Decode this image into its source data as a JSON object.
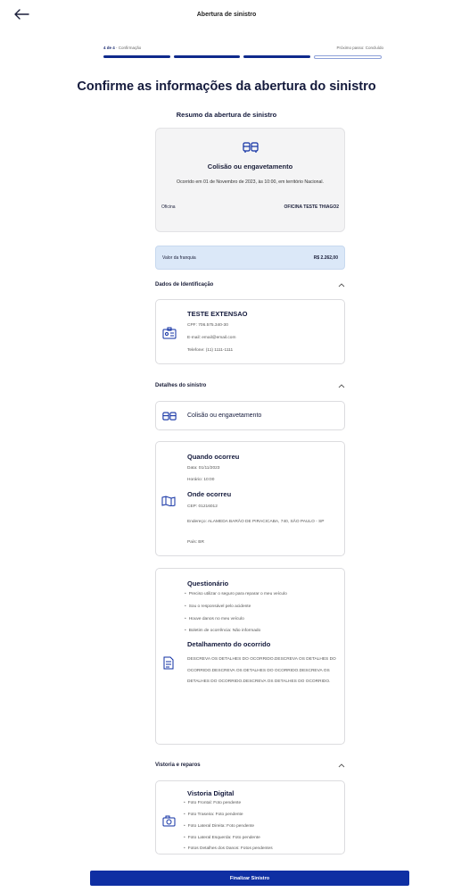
{
  "header": {
    "title": "Abertura de sinistro",
    "back_icon": "arrow-left-icon"
  },
  "progress": {
    "step": "4 de 4",
    "step_label": "- Confirmação",
    "next": "Próximo passo: Concluído",
    "segments_done": 3,
    "segments_total": 4
  },
  "page_title": "Confirme as informações da abertura do sinistro",
  "summary": {
    "heading": "Resumo da abertura de sinistro",
    "icon": "car-collision-icon",
    "type": "Colisão ou engavetamento",
    "occurred": "Ocorrido em 01 de Novembro de 2023, às 10:00, em território Nacional.",
    "workshop_label": "Oficina",
    "workshop_value": "OFICINA TESTE THIAGO2"
  },
  "franchise": {
    "label": "Valor da franquia",
    "value": "R$ 2.262,00"
  },
  "identification": {
    "title": "Dados de Identificação",
    "name": "TESTE EXTENSAO",
    "cpf": "CPF: 706.575.340-30",
    "email": "E-mail: email@email.com",
    "phone": "Telefone: (11) 1111-1111"
  },
  "details": {
    "title": "Detalhes do sinistro",
    "type": "Colisão ou engavetamento",
    "when_title": "Quando ocorreu",
    "date": "Data: 01/11/2023",
    "time": "Horário: 10:00",
    "where_title": "Onde ocorreu",
    "cep": "CEP: 01216012",
    "address": "Endereço: ALAMEDA BARÃO DE PIRACICABA, 740, SÃO PAULO - SP",
    "country": "País: BR"
  },
  "questionnaire": {
    "title": "Questionário",
    "items": [
      "Preciso utilizar o seguro para reparar o meu veículo",
      "Sou o responsável pelo acidente",
      "Houve danos no meu veículo",
      "Boletim de ocorrência: Não informado"
    ],
    "detail_title": "Detalhamento do ocorrido",
    "detail_text": "DESCREVA OS DETALHES DO OCORRIDO.DESCREVA OS DETALHES DO OCORRIDO.DESCREVA OS DETALHES DO OCORRIDO.DESCREVA OS DETALHES DO OCORRIDO.DESCREVA OS DETALHES DO OCORRIDO."
  },
  "inspection": {
    "title": "Vistoria e reparos",
    "card_title": "Vistoria Digital",
    "items": [
      "Foto Frontal: Foto pendente",
      "Foto Traseira: Foto pendente",
      "Foto Lateral Direita: Foto pendente",
      "Foto Lateral Esquerda: Foto pendente",
      "Fotos Detalhes dos Danos: Fotos pendentes"
    ]
  },
  "actions": {
    "finish": "Finalizar Sinistro"
  },
  "colors": {
    "primary": "#0f2fa3",
    "franchise_bg": "#dbe8f8"
  }
}
